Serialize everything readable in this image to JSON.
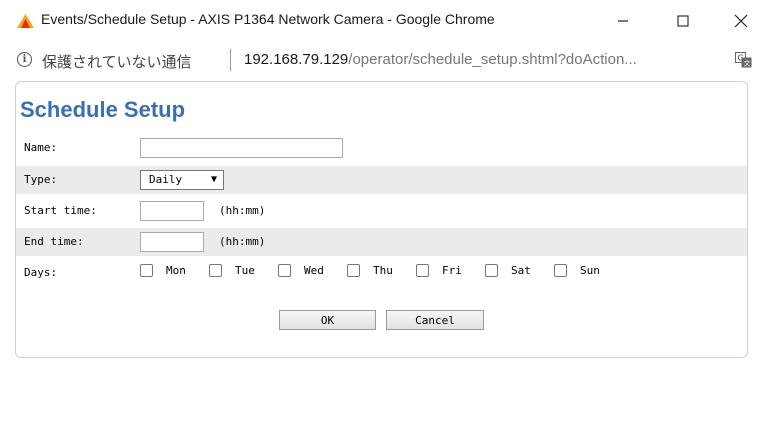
{
  "window": {
    "title": "Events/Schedule Setup - AXIS P1364 Network Camera - Google Chrome"
  },
  "address_bar": {
    "security_text": "保護されていない通信",
    "url_host": "192.168.79.129",
    "url_path": "/operator/schedule_setup.shtml?doAction..."
  },
  "form": {
    "title": "Schedule Setup",
    "name_label": "Name:",
    "name_value": "",
    "type_label": "Type:",
    "type_value": "Daily",
    "start_label": "Start time:",
    "start_value": "",
    "start_hint": "(hh:mm)",
    "end_label": "End time:",
    "end_value": "",
    "end_hint": "(hh:mm)",
    "days_label": "Days:",
    "days": [
      "Mon",
      "Tue",
      "Wed",
      "Thu",
      "Fri",
      "Sat",
      "Sun"
    ],
    "ok_label": "OK",
    "cancel_label": "Cancel"
  },
  "colors": {
    "title_blue": "#3a6fb8",
    "row_shade": "#ebebeb"
  }
}
